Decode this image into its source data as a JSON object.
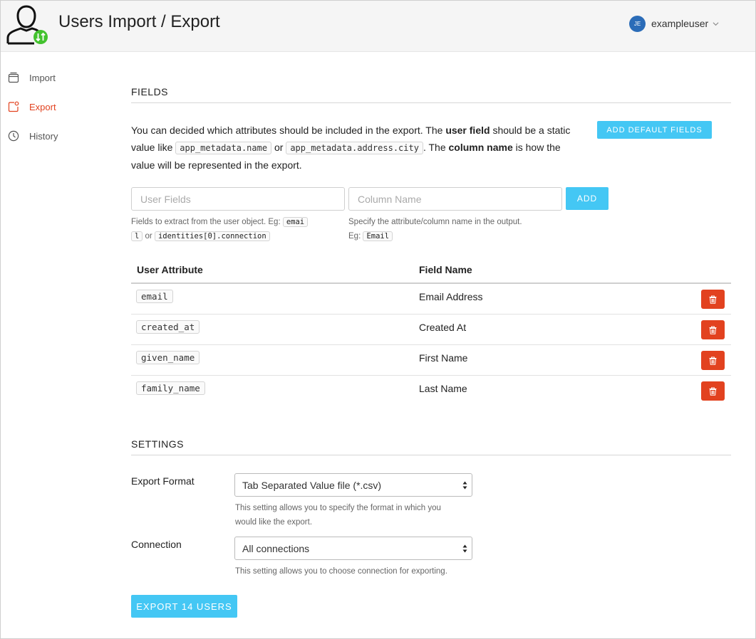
{
  "header": {
    "title": "Users Import / Export",
    "user": {
      "initials": "JE",
      "name": "exampleuser"
    },
    "accent": "#2b6cb8",
    "icon_badge_color": "#43c22e"
  },
  "sidebar": {
    "items": [
      {
        "label": "Import",
        "icon": "window-icon",
        "active": false
      },
      {
        "label": "Export",
        "icon": "export-icon",
        "active": true
      },
      {
        "label": "History",
        "icon": "clock-icon",
        "active": false
      }
    ],
    "active_color": "#e2421f"
  },
  "fields": {
    "title": "FIELDS",
    "desc": {
      "p1": "You can decided which attributes should be included in the export. The ",
      "user_field": "user field",
      "p2": " should be a static value like ",
      "code1": "app_metadata.name",
      "or": " or ",
      "code2": "app_metadata.address.city",
      "p3": ". The ",
      "column_name": "column name",
      "p4": " is how the value will be represented in the export."
    },
    "add_default_label": "ADD DEFAULT FIELDS",
    "user_fields_placeholder": "User Fields",
    "column_name_placeholder": "Column Name",
    "add_label": "ADD",
    "help_left": {
      "text": "Fields to extract from the user object. Eg: ",
      "code1a": "emai",
      "code1b": "l",
      "or": " or ",
      "code2": "identities[0].connection"
    },
    "help_right": {
      "text": "Specify the attribute/column name in the output.",
      "eg": "Eg: ",
      "code": "Email"
    },
    "button_color": "#44c7f4"
  },
  "table": {
    "headers": {
      "attribute": "User Attribute",
      "field": "Field Name"
    },
    "rows": [
      {
        "attribute": "email",
        "field": "Email Address"
      },
      {
        "attribute": "created_at",
        "field": "Created At"
      },
      {
        "attribute": "given_name",
        "field": "First Name"
      },
      {
        "attribute": "family_name",
        "field": "Last Name"
      }
    ],
    "delete_color": "#e2421f"
  },
  "settings": {
    "title": "SETTINGS",
    "export_format": {
      "label": "Export Format",
      "value": "Tab Separated Value file (*.csv)",
      "help_line1": "This setting allows you to specify the format in which you",
      "help_line2": "would like the export."
    },
    "connection": {
      "label": "Connection",
      "value": "All connections",
      "help": "This setting allows you to choose connection for exporting."
    },
    "export_button": "EXPORT 14 USERS"
  }
}
